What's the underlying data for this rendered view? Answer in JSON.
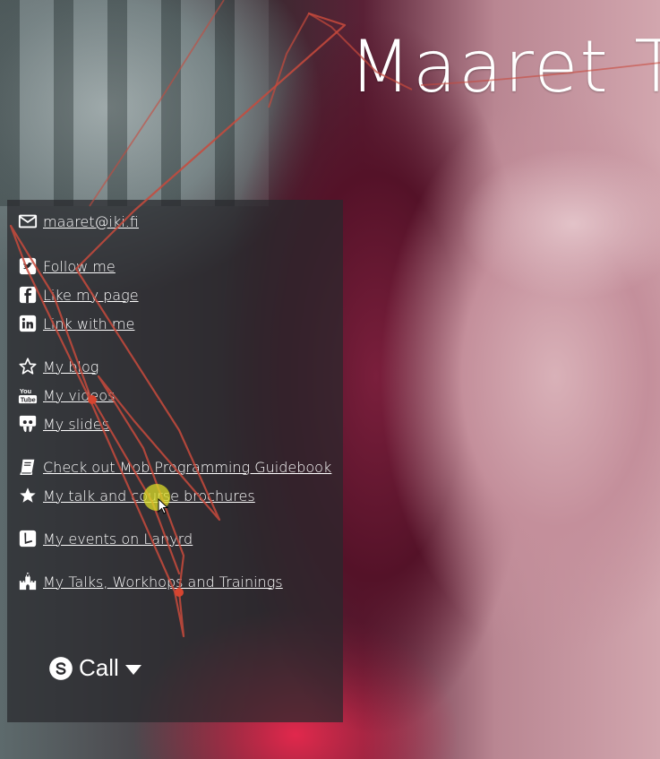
{
  "page": {
    "title": "Maaret T"
  },
  "links": {
    "email": "maaret@iki.fi",
    "twitter": "Follow me",
    "facebook": "Like my page",
    "linkedin": "Link with me",
    "blog": "My blog",
    "videos": "My videos",
    "slides": "My slides",
    "mob_book": "Check out Mob Programming Guidebook",
    "brochures": "My talk and course brochures",
    "lanyrd": "My events on Lanyrd",
    "talks": "My Talks, Workhops and Trainings"
  },
  "call": {
    "label": "Call"
  },
  "icons": {
    "email": "envelope-icon",
    "twitter": "twitter-icon",
    "facebook": "facebook-icon",
    "linkedin": "linkedin-icon",
    "blog": "star-outline-icon",
    "videos": "youtube-icon",
    "slides": "slideshare-icon",
    "mob_book": "book-icon",
    "brochures": "star-icon",
    "lanyrd": "lanyrd-icon",
    "talks": "castle-icon",
    "call": "skype-icon",
    "dropdown": "caret-down-icon"
  },
  "colors": {
    "panel": "#28282c",
    "text": "#ffffff",
    "scribble": "#c84a3c"
  }
}
